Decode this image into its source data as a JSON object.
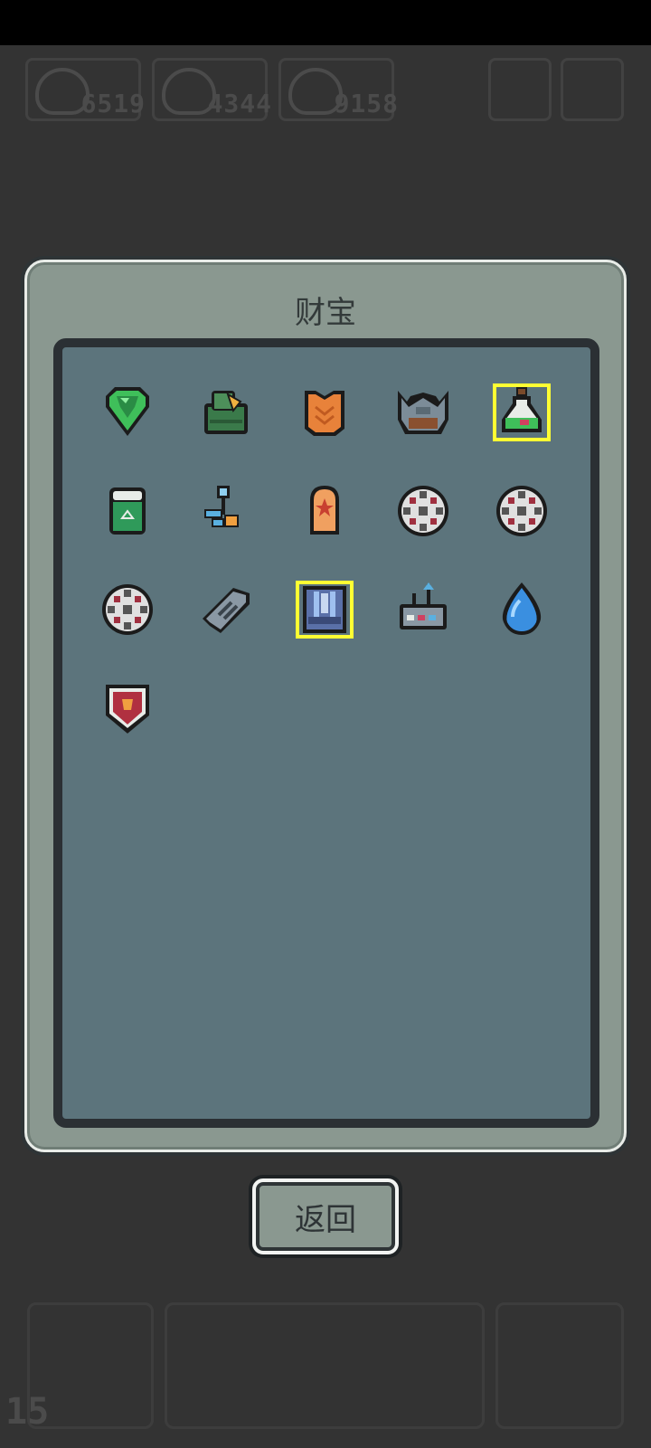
{
  "resources": [
    {
      "value": "6519"
    },
    {
      "value": "4344"
    },
    {
      "value": "9158"
    }
  ],
  "player": {
    "level": "15"
  },
  "dialog": {
    "title": "财宝",
    "back_label": "返回"
  },
  "treasures": [
    {
      "icon": "green-gem-icon",
      "highlighted": false
    },
    {
      "icon": "green-armor-icon",
      "highlighted": false
    },
    {
      "icon": "orange-vest-icon",
      "highlighted": false
    },
    {
      "icon": "horned-helmet-icon",
      "highlighted": false
    },
    {
      "icon": "potion-flask-icon",
      "highlighted": true
    },
    {
      "icon": "trash-bin-icon",
      "highlighted": false
    },
    {
      "icon": "blue-key-icon",
      "highlighted": false
    },
    {
      "icon": "orange-tombstone-icon",
      "highlighted": false
    },
    {
      "icon": "gear-wheel-icon",
      "highlighted": false
    },
    {
      "icon": "gear-wheel-icon",
      "highlighted": false
    },
    {
      "icon": "gear-wheel-icon",
      "highlighted": false
    },
    {
      "icon": "chain-link-icon",
      "highlighted": false
    },
    {
      "icon": "blue-armor-icon",
      "highlighted": true
    },
    {
      "icon": "antenna-device-icon",
      "highlighted": false
    },
    {
      "icon": "water-drop-icon",
      "highlighted": false
    },
    {
      "icon": "red-shield-icon",
      "highlighted": false
    }
  ],
  "colors": {
    "panel": "#8a9890",
    "inner": "#5c747c",
    "highlight": "#ffff33"
  }
}
